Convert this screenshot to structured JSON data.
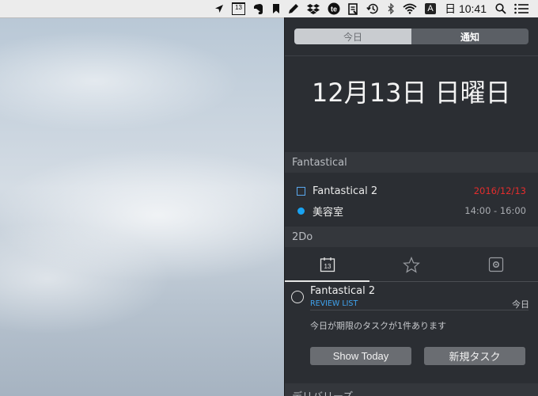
{
  "menubar": {
    "icons": [
      "location-arrow-icon",
      "calendar-icon",
      "evernote-icon",
      "bookmark-icon",
      "pencil-icon",
      "dropbox-icon",
      "te-icon",
      "document-icon",
      "time-machine-icon",
      "bluetooth-icon",
      "wifi-icon",
      "input-source-icon",
      "spotlight-icon",
      "notification-center-icon"
    ],
    "calendar_day": "13",
    "te_label": "te",
    "input_source": "A",
    "clock": "日 10:41"
  },
  "notification_center": {
    "tabs": [
      {
        "label": "今日",
        "active": false
      },
      {
        "label": "通知",
        "active": true
      }
    ],
    "date": "12月13日 日曜日",
    "fantastical": {
      "header": "Fantastical",
      "items": [
        {
          "label": "Fantastical 2",
          "right": "2016/12/13",
          "right_color": "#e32d2d",
          "marker": "checkbox"
        },
        {
          "label": "美容室",
          "right": "14:00 - 16:00",
          "right_color": "#a9acb1",
          "marker": "dot"
        }
      ]
    },
    "twodo": {
      "header": "2Do",
      "tab_icons": [
        "calendar-13-icon",
        "star-icon",
        "settings-icon"
      ],
      "calendar_day": "13",
      "task": {
        "title": "Fantastical 2",
        "list": "REVIEW LIST",
        "due": "今日"
      },
      "message": "今日が期限のタスクが1件あります",
      "buttons": {
        "show_today": "Show Today",
        "new_task": "新規タスク"
      }
    },
    "next_section": "デリバリーズ"
  },
  "colors": {
    "accent_blue": "#19a3f2",
    "due_red": "#e32d2d",
    "panel_bg": "#2b2e33"
  }
}
